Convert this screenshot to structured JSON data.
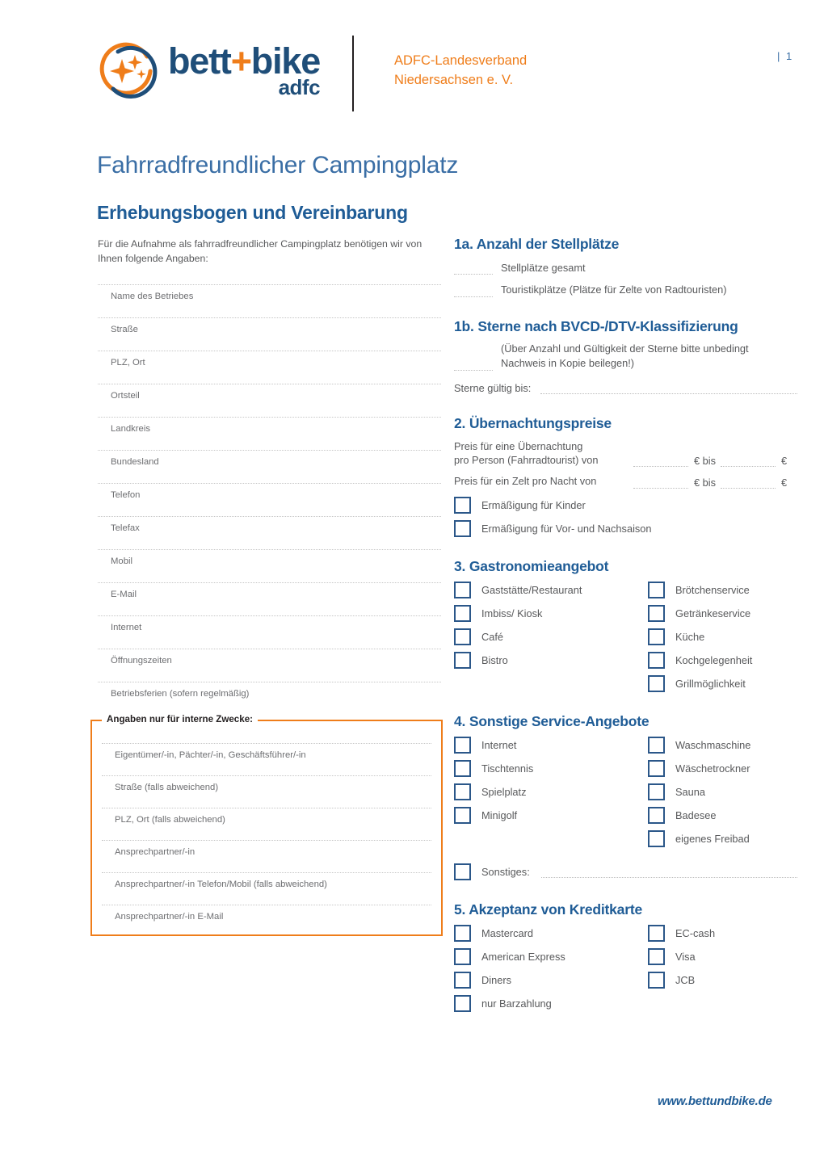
{
  "header": {
    "logo": {
      "wordmark_pre": "bett",
      "wordmark_plus": "+",
      "wordmark_post": "bike",
      "wordmark_sub": "adfc"
    },
    "org_line1": "ADFC-Landesverband",
    "org_line2": "Niedersachsen e. V.",
    "page_number": "| 1",
    "colors": {
      "orange": "#ef7d1a",
      "navy": "#1f4e79",
      "blue": "#1f5c96"
    }
  },
  "title": "Fahrradfreundlicher Campingplatz",
  "subtitle": "Erhebungsbogen und Vereinbarung",
  "intro": "Für die Aufnahme als fahrradfreundlicher Campingplatz benötigen wir von Ihnen folgende Angaben:",
  "left_fields": [
    "Name des Betriebes",
    "Straße",
    "PLZ, Ort",
    "Ortsteil",
    "Landkreis",
    "Bundesland",
    "Telefon",
    "Telefax",
    "Mobil",
    "E-Mail",
    "Internet",
    "Öffnungszeiten",
    "Betriebsferien (sofern regelmäßig)"
  ],
  "internal_box": {
    "legend": "Angaben nur für interne Zwecke:",
    "fields": [
      "Eigentümer/-in, Pächter/-in, Geschäftsführer/-in",
      "Straße (falls abweichend)",
      "PLZ, Ort (falls abweichend)",
      "Ansprechpartner/-in",
      "Ansprechpartner/-in Telefon/Mobil (falls abweichend)",
      "Ansprechpartner/-in E-Mail"
    ]
  },
  "section_1a": {
    "heading": "1a. Anzahl der Stellplätze",
    "items": [
      "Stellplätze gesamt",
      "Touristikplätze (Plätze für Zelte von Radtouristen)"
    ]
  },
  "section_1b": {
    "heading": "1b. Sterne nach BVCD-/DTV-Klassifizierung",
    "note": "(Über Anzahl und Gültigkeit der Sterne bitte unbedingt Nachweis in Kopie beilegen!)",
    "valid_label": "Sterne gültig bis:"
  },
  "section_2": {
    "heading": "2. Übernachtungspreise",
    "price_rows": [
      {
        "label": "Preis für eine Übernachtung\npro Person (Fahrradtourist) von",
        "unit1": "€ bis",
        "unit2": "€"
      },
      {
        "label": "Preis für ein Zelt pro Nacht von",
        "unit1": "€ bis",
        "unit2": "€"
      }
    ],
    "checkboxes": [
      "Ermäßigung für Kinder",
      "Ermäßigung für Vor- und Nachsaison"
    ]
  },
  "section_3": {
    "heading": "3. Gastronomieangebot",
    "col1": [
      "Gaststätte/Restaurant",
      "Imbiss/ Kiosk",
      "Café",
      "Bistro"
    ],
    "col2": [
      "Brötchenservice",
      "Getränkeservice",
      "Küche",
      "Kochgelegenheit",
      "Grillmöglichkeit"
    ]
  },
  "section_4": {
    "heading": "4. Sonstige Service-Angebote",
    "col1": [
      "Internet",
      "Tischtennis",
      "Spielplatz",
      "Minigolf"
    ],
    "col2": [
      "Waschmaschine",
      "Wäschetrockner",
      "Sauna",
      "Badesee",
      "eigenes Freibad"
    ],
    "other_label": "Sonstiges:"
  },
  "section_5": {
    "heading": "5. Akzeptanz von Kreditkarte",
    "col1": [
      "Mastercard",
      "American Express",
      "Diners",
      "nur Barzahlung"
    ],
    "col2": [
      "EC-cash",
      "Visa",
      "JCB"
    ]
  },
  "footer_url": "www.bettundbike.de"
}
